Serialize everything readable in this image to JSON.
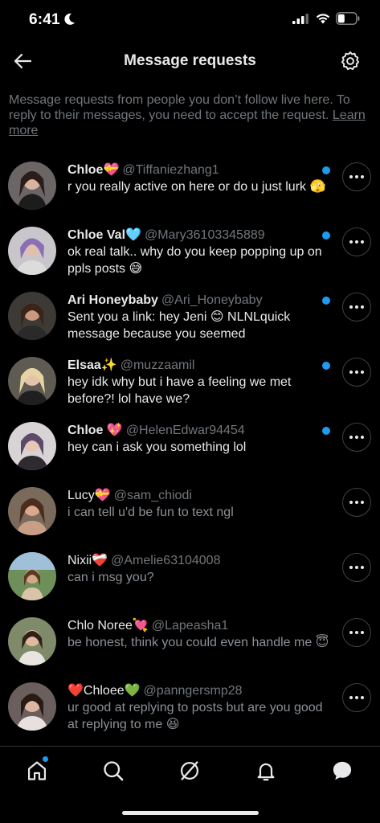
{
  "status": {
    "time": "6:41"
  },
  "header": {
    "title": "Message requests"
  },
  "info": {
    "text": "Message requests from people you don’t follow live here. To reply to their messages, you need to accept the request. ",
    "link": "Learn more"
  },
  "colors": {
    "accent": "#1d9bf0",
    "background": "#000000",
    "muted": "#71767b"
  },
  "requests": [
    {
      "name": "Chloe💝",
      "handle": "@Tiffaniezhang1",
      "message": "r you really active on here or do u just lurk 🫣",
      "unread": true
    },
    {
      "name": "Chloe Val🩵",
      "handle": "@Mary36103345889",
      "message": "ok real talk.. why do you keep popping up on ppls posts 😅",
      "unread": true
    },
    {
      "name": "Ari Honeybaby",
      "handle": "@Ari_Honeybaby",
      "message": "Sent you a link: hey Jeni 😊 NLNLquick message because you seemed",
      "unread": true
    },
    {
      "name": "Elsaa✨",
      "handle": "@muzzaamil",
      "message": "hey idk why but i have a feeling we met before?! lol have we?",
      "unread": true
    },
    {
      "name": "Chloe 💖",
      "handle": "@HelenEdwar94454",
      "message": "hey can i ask you something lol",
      "unread": true
    },
    {
      "name": "Lucy💝",
      "handle": "@sam_chiodi",
      "message": "i can tell u'd be fun to text ngl",
      "unread": false
    },
    {
      "name": "Nixii❤️‍🩹",
      "handle": "@Amelie63104008",
      "message": "can i msg you?",
      "unread": false
    },
    {
      "name": "Chlo Noree💘",
      "handle": "@Lapeasha1",
      "message": "be honest, think you could even handle me 😇",
      "unread": false
    },
    {
      "name": "❤️Chloee💚",
      "handle": "@panngersmp28",
      "message": "ur good at replying to posts but are you good at replying to me 😆",
      "unread": false
    }
  ],
  "tabs": [
    "home-icon",
    "search-icon",
    "grok-icon",
    "notifications-icon",
    "messages-icon"
  ]
}
